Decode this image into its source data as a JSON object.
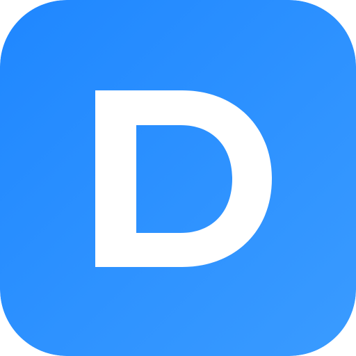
{
  "icon": {
    "name": "D",
    "semantic": "letter-d-logo-icon",
    "colors": {
      "gradient_start": "#1F87FF",
      "gradient_end": "#3A9BFF",
      "glyph": "#FFFFFF"
    }
  }
}
